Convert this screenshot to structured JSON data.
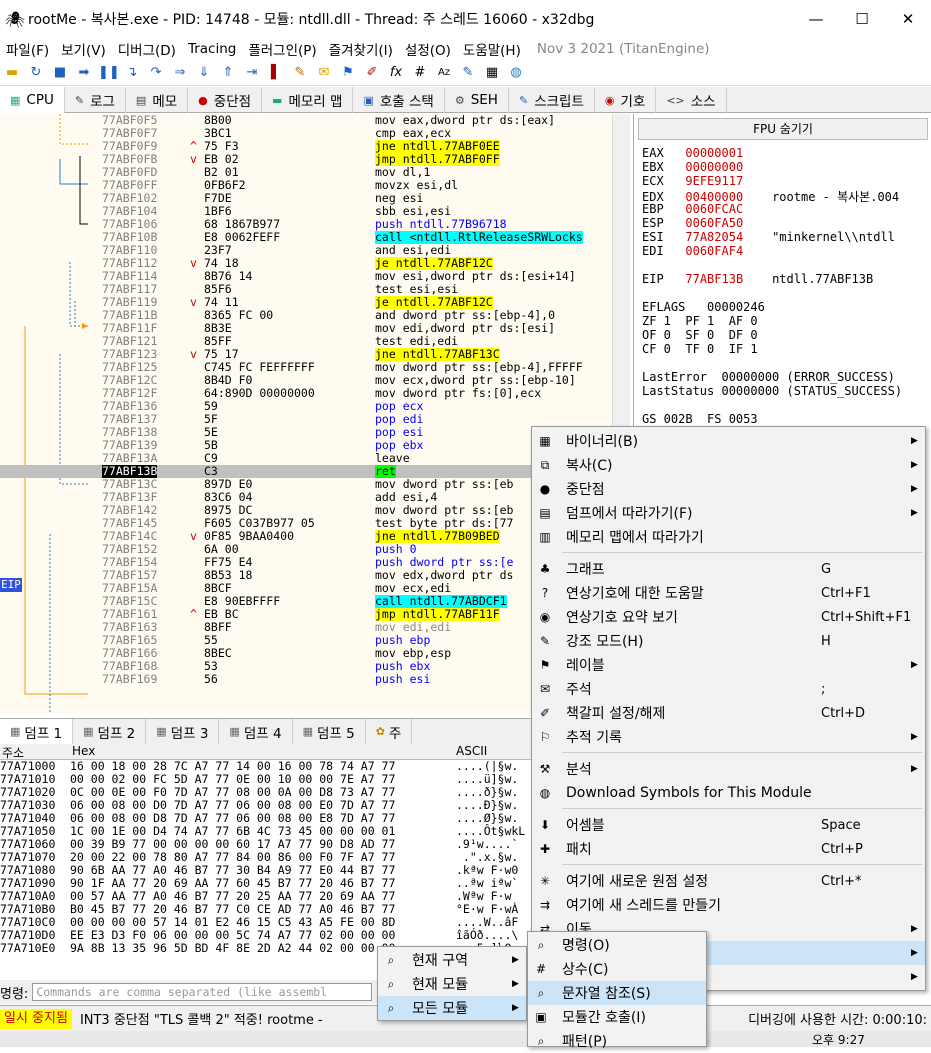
{
  "title": "rootMe - 복사본.exe - PID: 14748 - 모듈: ntdll.dll - Thread: 주 스레드 16060 - x32dbg",
  "menu": [
    "파일(F)",
    "보기(V)",
    "디버그(D)",
    "Tracing",
    "플러그인(P)",
    "즐겨찾기(I)",
    "설정(O)",
    "도움말(H)",
    "Nov 3 2021 (TitanEngine)"
  ],
  "tabs": [
    "CPU",
    "로그",
    "메모",
    "중단점",
    "메모리 맵",
    "호출 스택",
    "SEH",
    "스크립트",
    "기호",
    "소스"
  ],
  "disasm": [
    {
      "a": "77ABF0F5",
      "m": "",
      "b": "8B00",
      "d": "mov eax,dword ptr ds:[eax]",
      "k": ""
    },
    {
      "a": "77ABF0F7",
      "m": "",
      "b": "3BC1",
      "d": "cmp eax,ecx",
      "k": ""
    },
    {
      "a": "77ABF0F9",
      "m": "^",
      "b": "75 F3",
      "d": "jne ntdll.77ABF0EE",
      "k": "jmp"
    },
    {
      "a": "77ABF0FB",
      "m": "v",
      "b": "EB 02",
      "d": "jmp ntdll.77ABF0FF",
      "k": "jmp"
    },
    {
      "a": "77ABF0FD",
      "m": "",
      "b": "B2 01",
      "d": "mov dl,1",
      "k": ""
    },
    {
      "a": "77ABF0FF",
      "m": "",
      "b": "0FB6F2",
      "d": "movzx esi,dl",
      "k": ""
    },
    {
      "a": "77ABF102",
      "m": "",
      "b": "F7DE",
      "d": "neg esi",
      "k": ""
    },
    {
      "a": "77ABF104",
      "m": "",
      "b": "1BF6",
      "d": "sbb esi,esi",
      "k": ""
    },
    {
      "a": "77ABF106",
      "m": "",
      "b": "68 1867B977",
      "d": "push ntdll.77B96718",
      "k": "push"
    },
    {
      "a": "77ABF10B",
      "m": "",
      "b": "E8 0062FEFF",
      "d": "call <ntdll.RtlReleaseSRWLocks",
      "k": "call"
    },
    {
      "a": "77ABF110",
      "m": "",
      "b": "23F7",
      "d": "and esi,edi",
      "k": ""
    },
    {
      "a": "77ABF112",
      "m": "v",
      "b": "74 18",
      "d": "je ntdll.77ABF12C",
      "k": "jmp"
    },
    {
      "a": "77ABF114",
      "m": "",
      "b": "8B76 14",
      "d": "mov esi,dword ptr ds:[esi+14]",
      "k": ""
    },
    {
      "a": "77ABF117",
      "m": "",
      "b": "85F6",
      "d": "test esi,esi",
      "k": ""
    },
    {
      "a": "77ABF119",
      "m": "v",
      "b": "74 11",
      "d": "je ntdll.77ABF12C",
      "k": "jmp"
    },
    {
      "a": "77ABF11B",
      "m": "",
      "b": "8365 FC 00",
      "d": "and dword ptr ss:[ebp-4],0",
      "k": ""
    },
    {
      "a": "77ABF11F",
      "m": "",
      "b": "8B3E",
      "d": "mov edi,dword ptr ds:[esi]",
      "k": ""
    },
    {
      "a": "77ABF121",
      "m": "",
      "b": "85FF",
      "d": "test edi,edi",
      "k": ""
    },
    {
      "a": "77ABF123",
      "m": "v",
      "b": "75 17",
      "d": "jne ntdll.77ABF13C",
      "k": "jmp"
    },
    {
      "a": "77ABF125",
      "m": "",
      "b": "C745 FC FEFFFFFF",
      "d": "mov dword ptr ss:[ebp-4],FFFFF",
      "k": ""
    },
    {
      "a": "77ABF12C",
      "m": "",
      "b": "8B4D F0",
      "d": "mov ecx,dword ptr ss:[ebp-10]",
      "k": ""
    },
    {
      "a": "77ABF12F",
      "m": "",
      "b": "64:890D 00000000",
      "d": "mov dword ptr fs:[0],ecx",
      "k": ""
    },
    {
      "a": "77ABF136",
      "m": "",
      "b": "59",
      "d": "pop ecx",
      "k": "push"
    },
    {
      "a": "77ABF137",
      "m": "",
      "b": "5F",
      "d": "pop edi",
      "k": "push"
    },
    {
      "a": "77ABF138",
      "m": "",
      "b": "5E",
      "d": "pop esi",
      "k": "push"
    },
    {
      "a": "77ABF139",
      "m": "",
      "b": "5B",
      "d": "pop ebx",
      "k": "push"
    },
    {
      "a": "77ABF13A",
      "m": "",
      "b": "C9",
      "d": "leave",
      "k": ""
    },
    {
      "a": "77ABF13B",
      "m": "",
      "b": "C3",
      "d": "ret",
      "k": "ret"
    },
    {
      "a": "77ABF13C",
      "m": "",
      "b": "897D E0",
      "d": "mov dword ptr ss:[eb",
      "k": ""
    },
    {
      "a": "77ABF13F",
      "m": "",
      "b": "83C6 04",
      "d": "add esi,4",
      "k": ""
    },
    {
      "a": "77ABF142",
      "m": "",
      "b": "8975 DC",
      "d": "mov dword ptr ss:[eb",
      "k": ""
    },
    {
      "a": "77ABF145",
      "m": "",
      "b": "F605 C037B977 05",
      "d": "test byte ptr ds:[77",
      "k": ""
    },
    {
      "a": "77ABF14C",
      "m": "v",
      "b": "0F85 9BAA0400",
      "d": "jne ntdll.77B09BED",
      "k": "jmp"
    },
    {
      "a": "77ABF152",
      "m": "",
      "b": "6A 00",
      "d": "push 0",
      "k": "push"
    },
    {
      "a": "77ABF154",
      "m": "",
      "b": "FF75 E4",
      "d": "push dword ptr ss:[e",
      "k": "push"
    },
    {
      "a": "77ABF157",
      "m": "",
      "b": "8B53 18",
      "d": "mov edx,dword ptr ds",
      "k": ""
    },
    {
      "a": "77ABF15A",
      "m": "",
      "b": "8BCF",
      "d": "mov ecx,edi",
      "k": ""
    },
    {
      "a": "77ABF15C",
      "m": "",
      "b": "E8 90EBFFFF",
      "d": "call ntdll.77ABDCF1",
      "k": "call"
    },
    {
      "a": "77ABF161",
      "m": "^",
      "b": "EB BC",
      "d": "jmp ntdll.77ABF11F",
      "k": "jmp"
    },
    {
      "a": "77ABF163",
      "m": "",
      "b": "8BFF",
      "d": "mov edi,edi",
      "k": "grey"
    },
    {
      "a": "77ABF165",
      "m": "",
      "b": "55",
      "d": "push ebp",
      "k": "push"
    },
    {
      "a": "77ABF166",
      "m": "",
      "b": "8BEC",
      "d": "mov ebp,esp",
      "k": ""
    },
    {
      "a": "77ABF168",
      "m": "",
      "b": "53",
      "d": "push ebx",
      "k": "push"
    },
    {
      "a": "77ABF169",
      "m": "",
      "b": "56",
      "d": "push esi",
      "k": "push"
    }
  ],
  "eip_label": "EIP",
  "fpu_header": "FPU 숨기기",
  "registers": [
    {
      "n": "EAX",
      "v": "00000001",
      "c": ""
    },
    {
      "n": "EBX",
      "v": "00000000",
      "c": ""
    },
    {
      "n": "ECX",
      "v": "9EFE9117",
      "c": ""
    },
    {
      "n": "EDX",
      "v": "00400000",
      "c": "rootme - 복사본.004"
    },
    {
      "n": "EBP",
      "v": "0060FCAC",
      "c": ""
    },
    {
      "n": "ESP",
      "v": "0060FA50",
      "c": ""
    },
    {
      "n": "ESI",
      "v": "77A82054",
      "c": "\"minkernel\\\\ntdll"
    },
    {
      "n": "EDI",
      "v": "0060FAF4",
      "c": ""
    }
  ],
  "eip_reg": {
    "n": "EIP",
    "v": "77ABF13B",
    "c": "ntdll.77ABF13B"
  },
  "eflags": "EFLAGS   00000246",
  "flags1": "ZF 1  PF 1  AF 0",
  "flags2": "OF 0  SF 0  DF 0",
  "flags3": "CF 0  TF 0  IF 1",
  "lasterror": "LastError  00000000 (ERROR_SUCCESS)",
  "laststatus": "LastStatus 00000000 (STATUS_SUCCESS)",
  "segs": "GS 002B  FS 0053",
  "dump_tabs": [
    "덤프 1",
    "덤프 2",
    "덤프 3",
    "덤프 4",
    "덤프 5",
    "주"
  ],
  "dump_headers": {
    "addr": "주소",
    "hex": "Hex",
    "ascii": "ASCII"
  },
  "dump": [
    {
      "a": "77A71000",
      "h": "16 00 18 00 28 7C A7 77 14 00 16 00 78 74 A7 77",
      "s": "....(|§w."
    },
    {
      "a": "77A71010",
      "h": "00 00 02 00 FC 5D A7 77 0E 00 10 00 00 7E A7 77",
      "s": "....ü]§w."
    },
    {
      "a": "77A71020",
      "h": "0C 00 0E 00 F0 7D A7 77 08 00 0A 00 D8 73 A7 77",
      "s": "....ð}§w."
    },
    {
      "a": "77A71030",
      "h": "06 00 08 00 D0 7D A7 77 06 00 08 00 E0 7D A7 77",
      "s": "....Ð}§w."
    },
    {
      "a": "77A71040",
      "h": "06 00 08 00 D8 7D A7 77 06 00 08 00 E8 7D A7 77",
      "s": "....Ø}§w."
    },
    {
      "a": "77A71050",
      "h": "1C 00 1E 00 D4 74 A7 77 6B 4C 73 45 00 00 00 01",
      "s": "....Ôt§wkL"
    },
    {
      "a": "77A71060",
      "h": "00 39 B9 77 00 00 00 00 60 17 A7 77 90 D8 AD 77",
      "s": ".9¹w....`"
    },
    {
      "a": "77A71070",
      "h": "20 00 22 00 78 80 A7 77 84 00 86 00 F0 7F A7 77",
      "s": " .\".x.§w."
    },
    {
      "a": "77A71080",
      "h": "90 6B AA 77 A0 46 B7 77 30 B4 A9 77 E0 44 B7 77",
      "s": ".kªw F·w0"
    },
    {
      "a": "77A71090",
      "h": "90 1F AA 77 20 69 AA 77 60 45 B7 77 20 46 B7 77",
      "s": "..ªw iªw`"
    },
    {
      "a": "77A710A0",
      "h": "00 57 AA 77 A0 46 B7 77 20 25 AA 77 20 69 AA 77",
      "s": ".Wªw F·w "
    },
    {
      "a": "77A710B0",
      "h": "B0 45 B7 77 20 46 B7 77 C0 CE AD 77 A0 46 B7 77",
      "s": "°E·w F·wÀ"
    },
    {
      "a": "77A710C0",
      "h": "00 00 00 00 57 14 01 E2 46 15 C5 43 A5 FE 00 8D",
      "s": "....W..âF"
    },
    {
      "a": "77A710D0",
      "h": "EE E3 D3 F0 06 00 00 00 5C 74 A7 77 02 00 00 00",
      "s": "îãÓð....\\"
    },
    {
      "a": "77A710E0",
      "h": "9A 8B 13 35 96 5D BD 4F 8E 2D A2 44 02 00 00 00",
      "s": "...5.]½O."
    }
  ],
  "cmd_label": "명령:",
  "cmd_placeholder": "Commands are comma separated (like assembl",
  "status_paused": "일시 중지됨",
  "status_msg": "INT3 중단점 \"TLS 콜백 2\" 적중! rootme - ",
  "status_time": "디버깅에 사용한 시간: 0:00:10:",
  "clock": "오후 9:27",
  "context_menu": [
    {
      "label": "바이너리(B)",
      "short": "",
      "sub": true,
      "icon": "▦"
    },
    {
      "label": "복사(C)",
      "short": "",
      "sub": true,
      "icon": "⧉"
    },
    {
      "label": "중단점",
      "short": "",
      "sub": true,
      "icon": "●"
    },
    {
      "label": "덤프에서 따라가기(F)",
      "short": "",
      "sub": true,
      "icon": "▤"
    },
    {
      "label": "메모리 맵에서 따라가기",
      "short": "",
      "sub": false,
      "icon": "▥"
    },
    {
      "label": "그래프",
      "short": "G",
      "sub": false,
      "icon": "♣"
    },
    {
      "label": "연상기호에 대한 도움말",
      "short": "Ctrl+F1",
      "sub": false,
      "icon": "?"
    },
    {
      "label": "연상기호 요약 보기",
      "short": "Ctrl+Shift+F1",
      "sub": false,
      "icon": "◉"
    },
    {
      "label": "강조 모드(H)",
      "short": "H",
      "sub": false,
      "icon": "✎"
    },
    {
      "label": "레이블",
      "short": "",
      "sub": true,
      "icon": "⚑"
    },
    {
      "label": "주석",
      "short": ";",
      "sub": false,
      "icon": "✉"
    },
    {
      "label": "책갈피 설정/해제",
      "short": "Ctrl+D",
      "sub": false,
      "icon": "✐"
    },
    {
      "label": "추적 기록",
      "short": "",
      "sub": true,
      "icon": "⚐"
    },
    {
      "label": "분석",
      "short": "",
      "sub": true,
      "icon": "⚒"
    },
    {
      "label": "Download Symbols for This Module",
      "short": "",
      "sub": false,
      "icon": "◍"
    },
    {
      "label": "어셈블",
      "short": "Space",
      "sub": false,
      "icon": "⬇"
    },
    {
      "label": "패치",
      "short": "Ctrl+P",
      "sub": false,
      "icon": "✚"
    },
    {
      "label": "여기에 새로운 원점 설정",
      "short": "Ctrl+*",
      "sub": false,
      "icon": "✳"
    },
    {
      "label": "여기에 새 스레드를 만들기",
      "short": "",
      "sub": false,
      "icon": "⇉"
    },
    {
      "label": "이동",
      "short": "",
      "sub": true,
      "icon": "⇄"
    },
    {
      "label": "",
      "short": "",
      "sub": true,
      "icon": ""
    },
    {
      "label": "",
      "short": "",
      "sub": true,
      "icon": ""
    }
  ],
  "submenu1": [
    {
      "label": "명령(O)",
      "icon": "⌕"
    },
    {
      "label": "상수(C)",
      "icon": "#"
    },
    {
      "label": "문자열 참조(S)",
      "icon": "⌕"
    },
    {
      "label": "모듈간 호출(I)",
      "icon": "▣"
    },
    {
      "label": "패턴(P)",
      "icon": "⌕"
    }
  ],
  "submenu2": [
    {
      "label": "현재 구역",
      "icon": "⌕"
    },
    {
      "label": "현재 모듈",
      "icon": "⌕"
    },
    {
      "label": "모든 모듈",
      "icon": "⌕"
    }
  ]
}
